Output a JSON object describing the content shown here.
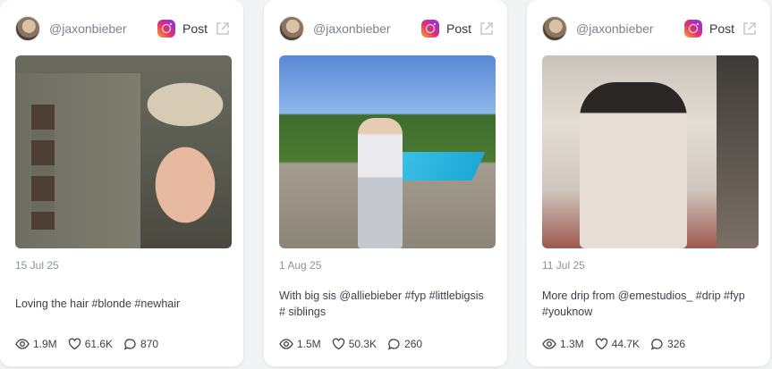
{
  "cards": [
    {
      "username": "@jaxonbieber",
      "post_label": "Post",
      "date": "15 Jul 25",
      "caption": "Loving the hair #blonde #newhair",
      "views": "1.9M",
      "likes": "61.6K",
      "comments": "870"
    },
    {
      "username": "@jaxonbieber",
      "post_label": "Post",
      "date": "1 Aug 25",
      "caption": "With big sis @alliebieber #fyp #littlebigsis # siblings",
      "views": "1.5M",
      "likes": "50.3K",
      "comments": "260"
    },
    {
      "username": "@jaxonbieber",
      "post_label": "Post",
      "date": "11 Jul 25",
      "caption": "More drip from @emestudios_ #drip #fyp #youknow",
      "views": "1.3M",
      "likes": "44.7K",
      "comments": "326"
    }
  ],
  "icons": {
    "platform": "instagram-icon",
    "external": "external-link-icon",
    "views": "eye-icon",
    "likes": "heart-icon",
    "comments": "comment-icon"
  },
  "colors": {
    "card_bg": "#ffffff",
    "page_bg": "#f2f3f5",
    "muted_text": "#8a90a0"
  }
}
